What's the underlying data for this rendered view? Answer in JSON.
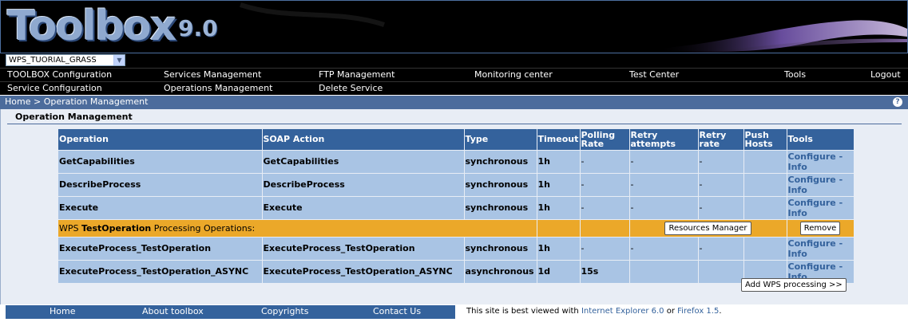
{
  "header": {
    "logo_text": "Toolbox",
    "logo_version": "9.0"
  },
  "service_select": {
    "selected": "WPS_TUORIAL_GRASS"
  },
  "menu_row1": [
    "TOOLBOX Configuration",
    "Services Management",
    "FTP Management",
    "Monitoring center",
    "Test Center",
    "Tools",
    "Logout"
  ],
  "menu_row2": [
    "Service Configuration",
    "Operations Management",
    "Delete Service"
  ],
  "breadcrumb": "Home > Operation Management",
  "help_icon": "?",
  "section_title": "Operation Management",
  "table": {
    "headers": [
      "Operation",
      "SOAP Action",
      "Type",
      "Timeout",
      "Polling Rate",
      "Retry attempts",
      "Retry rate",
      "Push Hosts",
      "Tools"
    ],
    "rows": [
      {
        "operation": "GetCapabilities",
        "soap_action": "GetCapabilities",
        "type": "synchronous",
        "timeout": "1h",
        "polling_rate": "-",
        "retry_attempts": "-",
        "retry_rate": "-",
        "push_hosts": "",
        "configure": "Configure",
        "sep": "-",
        "info": "Info"
      },
      {
        "operation": "DescribeProcess",
        "soap_action": "DescribeProcess",
        "type": "synchronous",
        "timeout": "1h",
        "polling_rate": "-",
        "retry_attempts": "-",
        "retry_rate": "-",
        "push_hosts": "",
        "configure": "Configure",
        "sep": "-",
        "info": "Info"
      },
      {
        "operation": "Execute",
        "soap_action": "Execute",
        "type": "synchronous",
        "timeout": "1h",
        "polling_rate": "-",
        "retry_attempts": "-",
        "retry_rate": "-",
        "push_hosts": "",
        "configure": "Configure",
        "sep": "-",
        "info": "Info"
      },
      {
        "operation": "ExecuteProcess_TestOperation",
        "soap_action": "ExecuteProcess_TestOperation",
        "type": "synchronous",
        "timeout": "1h",
        "polling_rate": "-",
        "retry_attempts": "-",
        "retry_rate": "-",
        "push_hosts": "",
        "configure": "Configure",
        "sep": "-",
        "info": "Info"
      },
      {
        "operation": "ExecuteProcess_TestOperation_ASYNC",
        "soap_action": "ExecuteProcess_TestOperation_ASYNC",
        "type": "asynchronous",
        "timeout": "1d",
        "polling_rate": "15s",
        "retry_attempts": "",
        "retry_rate": "",
        "push_hosts": "",
        "configure": "Configure",
        "sep": "-",
        "info": "Info"
      }
    ],
    "group": {
      "prefix": "WPS ",
      "name": "TestOperation",
      "suffix": " Processing Operations:",
      "resources_button": "Resources Manager",
      "remove_button": "Remove"
    }
  },
  "add_button": "Add WPS processing >>",
  "footer": {
    "links": [
      "Home",
      "About toolbox",
      "Copyrights",
      "Contact Us"
    ],
    "note_prefix": "This site is best viewed with ",
    "ie_link": "Internet Explorer 6.0",
    "note_or": " or ",
    "ff_link": "Firefox 1.5",
    "note_end": "."
  },
  "colors": {
    "header_bg": "#34629c",
    "row_bg": "#a9c4e4",
    "group_bg": "#eba829",
    "breadcrumb_bg": "#4c6c9c"
  }
}
